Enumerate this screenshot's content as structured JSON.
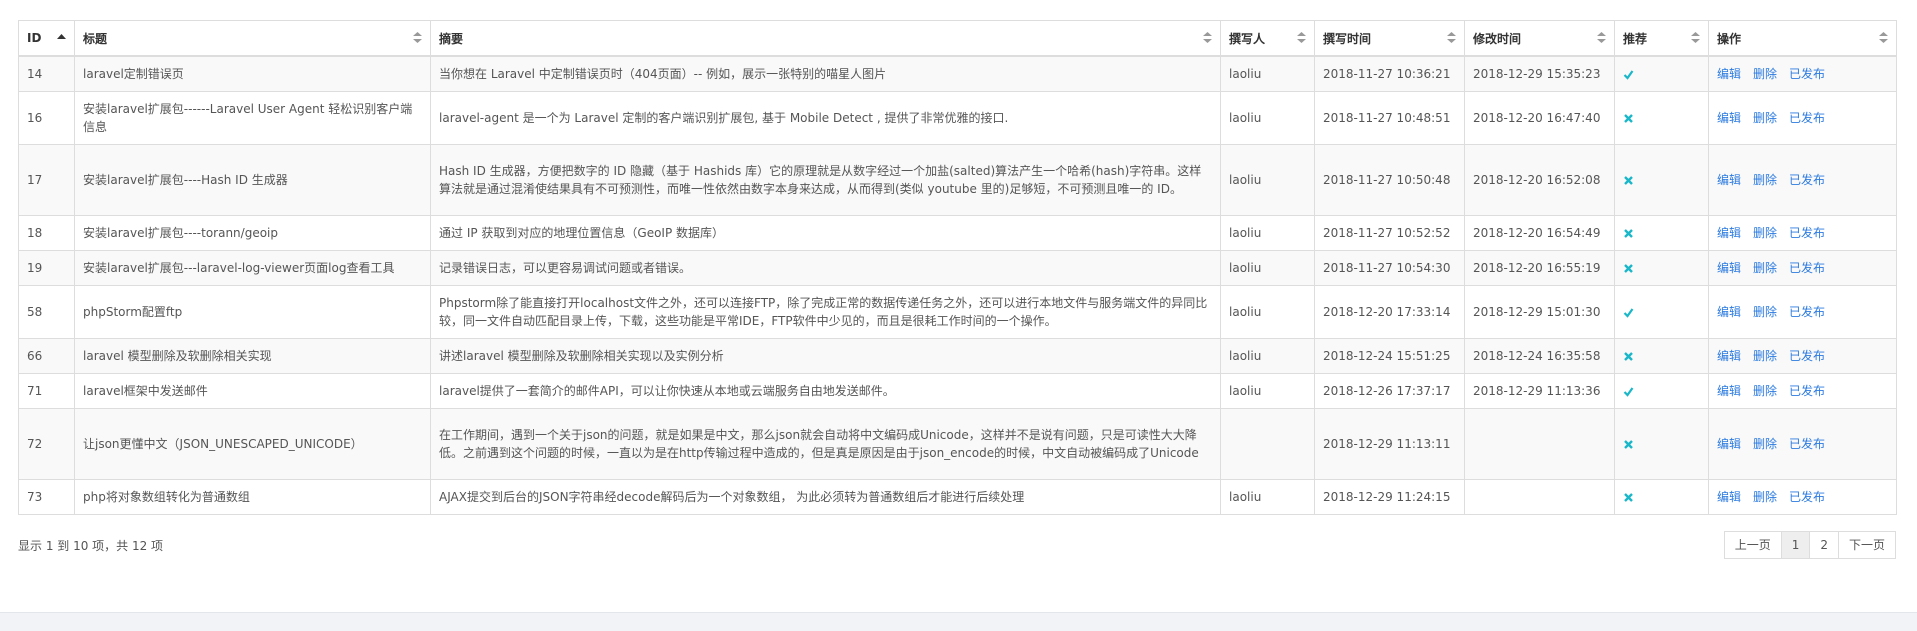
{
  "table": {
    "headers": [
      "ID",
      "标题",
      "摘要",
      "撰写人",
      "撰写时间",
      "修改时间",
      "推荐",
      "操作"
    ],
    "rows": [
      {
        "id": "14",
        "title": "laravel定制错误页",
        "summary": "当你想在 Laravel 中定制错误页时（404页面）-- 例如，展示一张特别的喵星人图片",
        "author": "laoliu",
        "created": "2018-11-27 10:36:21",
        "modified": "2018-12-29 15:35:23",
        "recommended": "yes"
      },
      {
        "id": "16",
        "title": "安装laravel扩展包------Laravel User Agent 轻松识别客户端信息",
        "summary": "laravel-agent 是一个为 Laravel 定制的客户端识别扩展包, 基于 Mobile Detect , 提供了非常优雅的接口.",
        "author": "laoliu",
        "created": "2018-11-27 10:48:51",
        "modified": "2018-12-20 16:47:40",
        "recommended": "no"
      },
      {
        "id": "17",
        "title": "安装laravel扩展包----Hash ID 生成器",
        "summary": "Hash ID 生成器，方便把数字的 ID 隐藏（基于 Hashids 库）它的原理就是从数字经过一个加盐(salted)算法产生一个哈希(hash)字符串。这样算法就是通过混淆使结果具有不可预测性，而唯一性依然由数字本身来达成，从而得到(类似 youtube 里的)足够短，不可预测且唯一的 ID。",
        "author": "laoliu",
        "created": "2018-11-27 10:50:48",
        "modified": "2018-12-20 16:52:08",
        "recommended": "no"
      },
      {
        "id": "18",
        "title": "安装laravel扩展包----torann/geoip",
        "summary": "通过 IP 获取到对应的地理位置信息（GeoIP 数据库）",
        "author": "laoliu",
        "created": "2018-11-27 10:52:52",
        "modified": "2018-12-20 16:54:49",
        "recommended": "no"
      },
      {
        "id": "19",
        "title": "安装laravel扩展包---laravel-log-viewer页面log查看工具",
        "summary": "记录错误日志，可以更容易调试问题或者错误。",
        "author": "laoliu",
        "created": "2018-11-27 10:54:30",
        "modified": "2018-12-20 16:55:19",
        "recommended": "no"
      },
      {
        "id": "58",
        "title": "phpStorm配置ftp",
        "summary": "Phpstorm除了能直接打开localhost文件之外，还可以连接FTP，除了完成正常的数据传递任务之外，还可以进行本地文件与服务端文件的异同比较，同一文件自动匹配目录上传，下载，这些功能是平常IDE，FTP软件中少见的，而且是很耗工作时间的一个操作。",
        "author": "laoliu",
        "created": "2018-12-20 17:33:14",
        "modified": "2018-12-29 15:01:30",
        "recommended": "yes"
      },
      {
        "id": "66",
        "title": "laravel 模型删除及软删除相关实现",
        "summary": "讲述laravel 模型删除及软删除相关实现以及实例分析",
        "author": "laoliu",
        "created": "2018-12-24 15:51:25",
        "modified": "2018-12-24 16:35:58",
        "recommended": "no"
      },
      {
        "id": "71",
        "title": "laravel框架中发送邮件",
        "summary": "laravel提供了一套简介的邮件API，可以让你快速从本地或云端服务自由地发送邮件。",
        "author": "laoliu",
        "created": "2018-12-26 17:37:17",
        "modified": "2018-12-29 11:13:36",
        "recommended": "yes"
      },
      {
        "id": "72",
        "title": "让json更懂中文（JSON_UNESCAPED_UNICODE）",
        "summary": "在工作期间，遇到一个关于json的问题，就是如果是中文，那么json就会自动将中文编码成Unicode，这样并不是说有问题，只是可读性大大降低。之前遇到这个问题的时候，一直以为是在http传输过程中造成的，但是真是原因是由于json_encode的时候，中文自动被编码成了Unicode",
        "author": "",
        "created": "2018-12-29 11:13:11",
        "modified": "",
        "recommended": "no"
      },
      {
        "id": "73",
        "title": "php将对象数组转化为普通数组",
        "summary": "AJAX提交到后台的JSON字符串经decode解码后为一个对象数组， 为此必须转为普通数组后才能进行后续处理",
        "author": "laoliu",
        "created": "2018-12-29 11:24:15",
        "modified": "",
        "recommended": "no"
      }
    ],
    "actions": {
      "edit": "编辑",
      "delete": "删除",
      "published": "已发布"
    }
  },
  "footer": {
    "info": "显示 1 到 10 项，共 12 项",
    "prev": "上一页",
    "pages": [
      "1",
      "2"
    ],
    "next": "下一页"
  },
  "colors": {
    "link": "#2c7be0",
    "check": "#1ab7c8",
    "border": "#dddddd",
    "stripe": "#f9f9f9"
  }
}
